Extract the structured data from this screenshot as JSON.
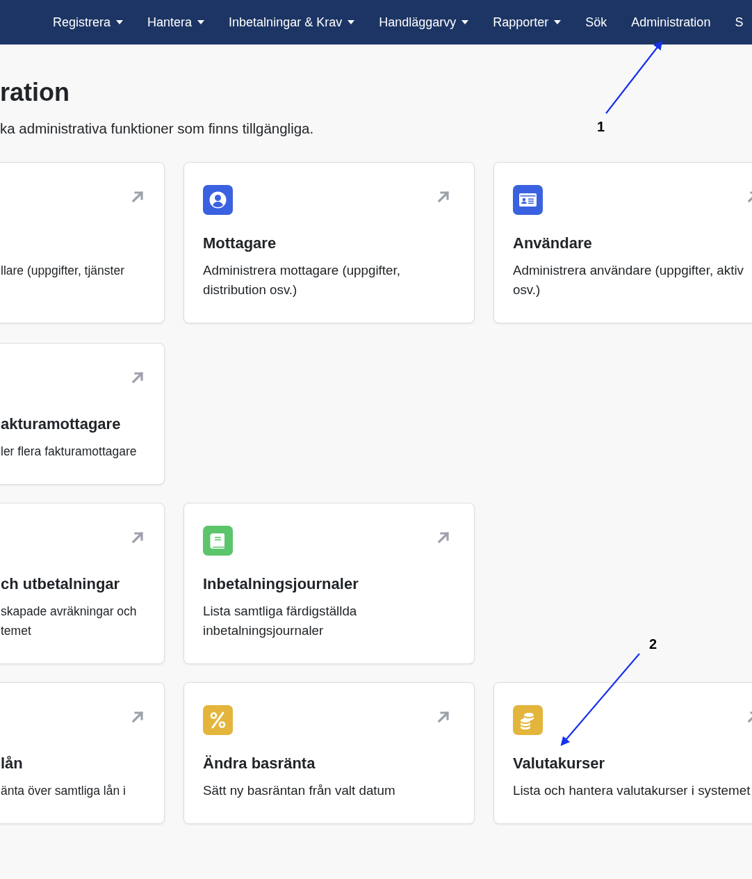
{
  "nav": {
    "items": [
      {
        "label": "Registrera",
        "dropdown": true
      },
      {
        "label": "Hantera",
        "dropdown": true
      },
      {
        "label": "Inbetalningar & Krav",
        "dropdown": true
      },
      {
        "label": "Handläggarvy",
        "dropdown": true
      },
      {
        "label": "Rapporter",
        "dropdown": true
      },
      {
        "label": "Sök",
        "dropdown": false
      },
      {
        "label": "Administration",
        "dropdown": false
      },
      {
        "label": "S",
        "dropdown": false
      }
    ]
  },
  "page": {
    "title": "ration",
    "subtitle": "ka administrativa funktioner som finns tillgängliga."
  },
  "groups": [
    {
      "cards": [
        {
          "description": "llare (uppgifter, tjänster"
        },
        {
          "kind": "person",
          "title": "Mottagare",
          "description": "Administrera mottagare (uppgifter, distribution osv.)"
        },
        {
          "kind": "id-card",
          "title": "Användare",
          "description": "Administrera användare (uppgifter, aktiv osv.)"
        },
        {
          "title": "akturamottagare",
          "description": "ler flera fakturamottagare"
        }
      ]
    },
    {
      "cards": [
        {
          "title": "ch utbetalningar",
          "description": "skapade avräkningar och\ntemet"
        },
        {
          "kind": "book",
          "title": "Inbetalningsjournaler",
          "description": "Lista samtliga färdigställda inbetalningsjournaler"
        }
      ]
    },
    {
      "cards": [
        {
          "title": "lån",
          "description": "änta över samtliga lån i"
        },
        {
          "kind": "percent",
          "title": "Ändra basränta",
          "description": "Sätt ny basräntan från valt datum"
        },
        {
          "kind": "coins",
          "title": "Valutakurser",
          "description": "Lista och hantera valutakurser i systemet"
        }
      ]
    }
  ],
  "annotations": [
    {
      "label": "1"
    },
    {
      "label": "2"
    }
  ]
}
